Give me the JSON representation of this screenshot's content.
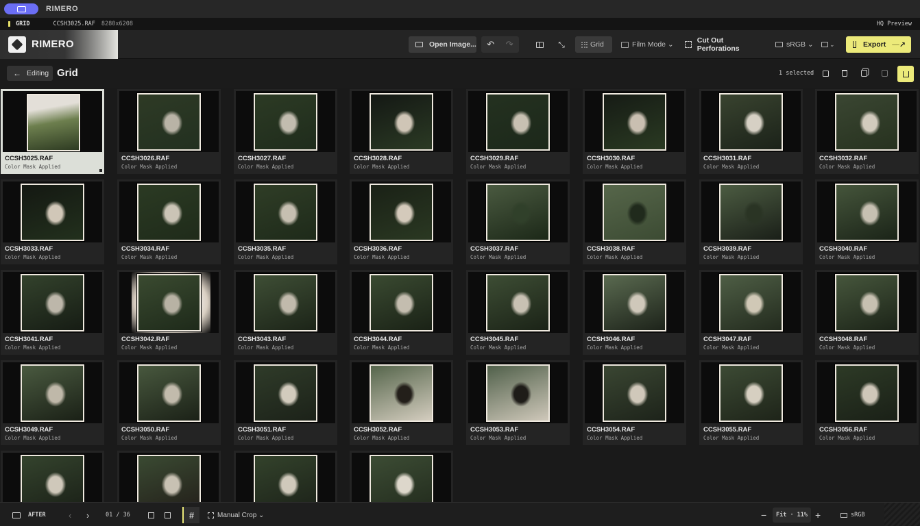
{
  "window": {
    "app_name": "RIMERO"
  },
  "infobar": {
    "mode": "GRID",
    "filename": "CCSH3025.RAF",
    "dimensions": "8280x6208",
    "preview": "HQ Preview"
  },
  "toolbar": {
    "logo_text": "RIMERO",
    "open_image": "Open Image...",
    "undo_icon": "↶",
    "redo_icon": "↷",
    "expand_icon": "⤡",
    "grid_label": "Grid",
    "film_mode": "Film Mode ⌄",
    "cut_perforations": "Cut Out Perforations",
    "color_space": "sRGB ⌄",
    "layout_chevron": "⌄",
    "export_label": "Export",
    "export_dash": "—",
    "export_arrow": "↗"
  },
  "header": {
    "back_label": "Editing",
    "back_arrow": "←",
    "title": "Grid",
    "selected": "1 selected"
  },
  "images": [
    {
      "name": "CCSH3025.RAF",
      "status": "Color Mask Applied",
      "selected": true,
      "orient": "portrait",
      "tone": [
        "#e3dfd8",
        "#6d7f4e",
        "#2e3b22"
      ]
    },
    {
      "name": "CCSH3026.RAF",
      "status": "Color Mask Applied",
      "orient": "landscape",
      "tone": [
        "#2e3a25",
        "#b9b3a6",
        "#223020"
      ]
    },
    {
      "name": "CCSH3027.RAF",
      "status": "Color Mask Applied",
      "orient": "landscape",
      "tone": [
        "#2c3a24",
        "#c2bcaf",
        "#1f2c1c"
      ]
    },
    {
      "name": "CCSH3028.RAF",
      "status": "Color Mask Applied",
      "orient": "landscape",
      "tone": [
        "#141814",
        "#cfc5b6",
        "#2b3a24"
      ]
    },
    {
      "name": "CCSH3029.RAF",
      "status": "Color Mask Applied",
      "orient": "landscape",
      "tone": [
        "#243120",
        "#c8c0b2",
        "#1c281a"
      ]
    },
    {
      "name": "CCSH3030.RAF",
      "status": "Color Mask Applied",
      "orient": "landscape",
      "tone": [
        "#161b15",
        "#c9bfb1",
        "#2a3a22"
      ]
    },
    {
      "name": "CCSH3031.RAF",
      "status": "Color Mask Applied",
      "orient": "landscape",
      "tone": [
        "#39432f",
        "#d6d0c4",
        "#1b2219"
      ]
    },
    {
      "name": "CCSH3032.RAF",
      "status": "Color Mask Applied",
      "orient": "landscape",
      "tone": [
        "#3a4632",
        "#d2cbbd",
        "#27321f"
      ]
    },
    {
      "name": "CCSH3033.RAF",
      "status": "Color Mask Applied",
      "orient": "landscape",
      "tone": [
        "#141812",
        "#d1c7b8",
        "#22301d"
      ]
    },
    {
      "name": "CCSH3034.RAF",
      "status": "Color Mask Applied",
      "orient": "landscape",
      "tone": [
        "#2b3a23",
        "#cbc4b6",
        "#1f2b1a"
      ]
    },
    {
      "name": "CCSH3035.RAF",
      "status": "Color Mask Applied",
      "orient": "landscape",
      "tone": [
        "#2f3d26",
        "#c6bfb1",
        "#1e2a1a"
      ]
    },
    {
      "name": "CCSH3036.RAF",
      "status": "Color Mask Applied",
      "orient": "landscape",
      "tone": [
        "#1a2116",
        "#d4cabb",
        "#2a3822"
      ]
    },
    {
      "name": "CCSH3037.RAF",
      "status": "Color Mask Applied",
      "orient": "landscape",
      "tone": [
        "#4a5a40",
        "#30402a",
        "#1c2818"
      ]
    },
    {
      "name": "CCSH3038.RAF",
      "status": "Color Mask Applied",
      "orient": "landscape",
      "tone": [
        "#56664a",
        "#202a1c",
        "#3c4b33"
      ]
    },
    {
      "name": "CCSH3039.RAF",
      "status": "Color Mask Applied",
      "orient": "landscape",
      "tone": [
        "#4c5c42",
        "#2a3424",
        "#1a1f18"
      ]
    },
    {
      "name": "CCSH3040.RAF",
      "status": "Color Mask Applied",
      "orient": "landscape",
      "tone": [
        "#45553b",
        "#c7c0b2",
        "#1b2418"
      ]
    },
    {
      "name": "CCSH3041.RAF",
      "status": "Color Mask Applied",
      "orient": "landscape",
      "tone": [
        "#33422c",
        "#bdb7aa",
        "#161c14"
      ]
    },
    {
      "name": "CCSH3042.RAF",
      "status": "Color Mask Applied",
      "orient": "landscape",
      "glow": true,
      "tone": [
        "#3a4a30",
        "#b8b2a4",
        "#1e2a1a"
      ]
    },
    {
      "name": "CCSH3043.RAF",
      "status": "Color Mask Applied",
      "orient": "landscape",
      "tone": [
        "#3e4e35",
        "#c1baac",
        "#1c2418"
      ]
    },
    {
      "name": "CCSH3044.RAF",
      "status": "Color Mask Applied",
      "orient": "landscape",
      "tone": [
        "#3a4a31",
        "#c4bdaf",
        "#1a2216"
      ]
    },
    {
      "name": "CCSH3045.RAF",
      "status": "Color Mask Applied",
      "orient": "landscape",
      "tone": [
        "#3d4d34",
        "#c8c1b3",
        "#1b2317"
      ]
    },
    {
      "name": "CCSH3046.RAF",
      "status": "Color Mask Applied",
      "orient": "landscape",
      "tone": [
        "#5a6a50",
        "#cfc8ba",
        "#1d231a"
      ]
    },
    {
      "name": "CCSH3047.RAF",
      "status": "Color Mask Applied",
      "orient": "landscape",
      "tone": [
        "#4e5e45",
        "#d0c8b6",
        "#232b1e"
      ]
    },
    {
      "name": "CCSH3048.RAF",
      "status": "Color Mask Applied",
      "orient": "landscape",
      "tone": [
        "#46563c",
        "#c7c0b1",
        "#1c2418"
      ]
    },
    {
      "name": "CCSH3049.RAF",
      "status": "Color Mask Applied",
      "orient": "landscape",
      "tone": [
        "#4a5a40",
        "#bfb8a9",
        "#1a2016"
      ]
    },
    {
      "name": "CCSH3050.RAF",
      "status": "Color Mask Applied",
      "orient": "landscape",
      "tone": [
        "#48583e",
        "#c2bbac",
        "#1b2117"
      ]
    },
    {
      "name": "CCSH3051.RAF",
      "status": "Color Mask Applied",
      "orient": "landscape",
      "tone": [
        "#2f3b29",
        "#d2cbbd",
        "#1c2219"
      ]
    },
    {
      "name": "CCSH3052.RAF",
      "status": "Color Mask Applied",
      "orient": "landscape",
      "tone": [
        "#55654b",
        "#231f1a",
        "#d4cdbf"
      ]
    },
    {
      "name": "CCSH3053.RAF",
      "status": "Color Mask Applied",
      "orient": "landscape",
      "tone": [
        "#50604a",
        "#1e1c18",
        "#cfc8ba"
      ]
    },
    {
      "name": "CCSH3054.RAF",
      "status": "Color Mask Applied",
      "orient": "landscape",
      "tone": [
        "#3a4632",
        "#d0c8ba",
        "#1d231a"
      ]
    },
    {
      "name": "CCSH3055.RAF",
      "status": "Color Mask Applied",
      "orient": "landscape",
      "tone": [
        "#3c4a34",
        "#d6cfc1",
        "#1e2419"
      ]
    },
    {
      "name": "CCSH3056.RAF",
      "status": "Color Mask Applied",
      "orient": "landscape",
      "tone": [
        "#2d3a26",
        "#cfc7b9",
        "#1a2017"
      ]
    },
    {
      "name": "",
      "status": "",
      "orient": "landscape",
      "tone": [
        "#34432d",
        "#cfc8ba",
        "#1a2017"
      ]
    },
    {
      "name": "",
      "status": "",
      "orient": "landscape",
      "tone": [
        "#3a4a32",
        "#c8c1b3",
        "#231f1a"
      ]
    },
    {
      "name": "",
      "status": "",
      "orient": "landscape",
      "tone": [
        "#33422b",
        "#d0c9bb",
        "#1c2219"
      ]
    },
    {
      "name": "",
      "status": "",
      "orient": "landscape",
      "tone": [
        "#3c4c34",
        "#ddd7cb",
        "#222b1d"
      ]
    }
  ],
  "footer": {
    "after_label": "AFTER",
    "prev_icon": "‹",
    "next_icon": "›",
    "page": "01 / 36",
    "grid_glyph": "#",
    "crop_label": "Manual Crop ⌄",
    "zoom_minus": "−",
    "zoom_label": "Fit · 11%",
    "zoom_plus": "+",
    "color_space": "sRGB"
  },
  "colors": {
    "accent": "#ecea7a",
    "app_pill": "#6b6ef5",
    "background": "#1a1a1a",
    "card": "#242424",
    "selected_card": "#dcdfd8"
  }
}
